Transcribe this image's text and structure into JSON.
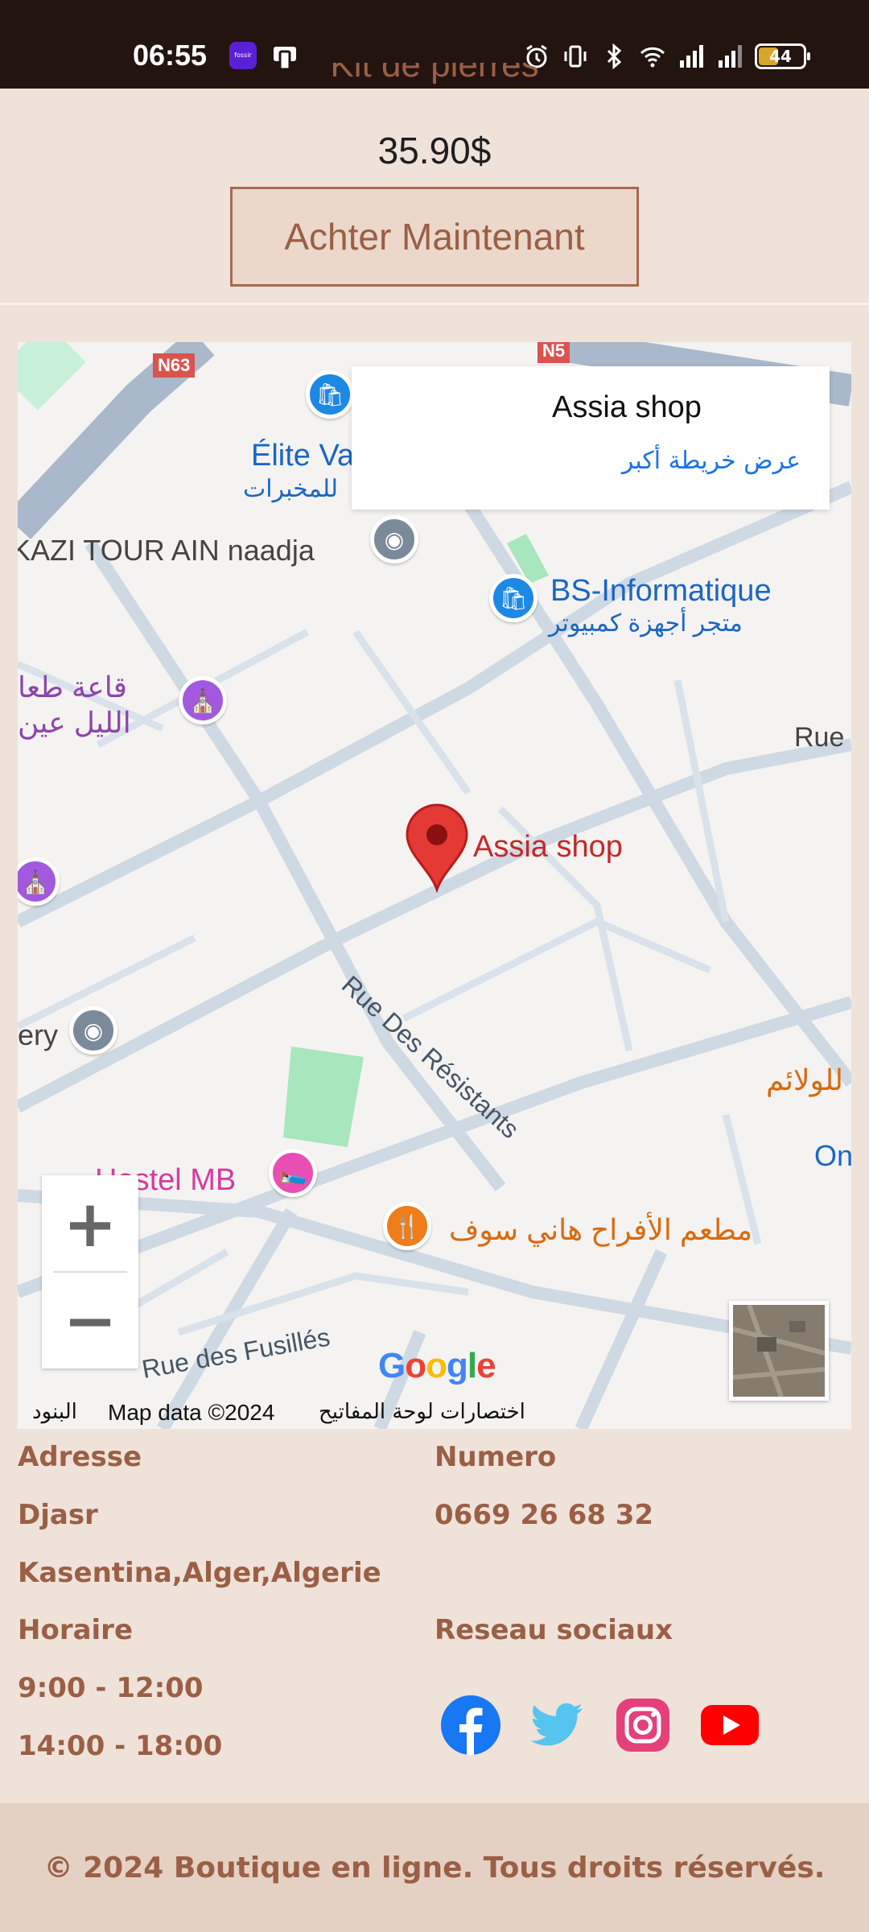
{
  "status_bar": {
    "time": "06:55",
    "app_icon_label": "fossir",
    "battery": "44",
    "icons": [
      "alarm-icon",
      "vibrate-icon",
      "bluetooth-icon",
      "wifi-icon",
      "signal-icon",
      "signal-icon",
      "battery-icon"
    ]
  },
  "product": {
    "name": "Kit de pierres",
    "price": "35.90$",
    "buy_label": "Achter Maintenant"
  },
  "map": {
    "info_card": {
      "title": "Assia shop",
      "larger_map_link": "عرض خريطة أكبر"
    },
    "marker_label": "Assia shop",
    "labels": {
      "road_n63": "N63",
      "road_n5": "N5",
      "elite": "Élite Va",
      "elite_ar": "للمخبرات",
      "kazi": "KAZI TOUR AIN naadja",
      "bs_info": "BS-Informatique",
      "bs_info_ar": "متجر أجهزة كمبيوتر",
      "hall_ar_1": "قاعة طعا",
      "hall_ar_2": "الليل عين",
      "rue_right": "Rue",
      "rue_resistants": "Rue Des Résistants",
      "ery": "ery",
      "hostel": "Hostel MB",
      "wedding": "مطعم الأفراح هاني سوف",
      "walaim": "للولائم",
      "on": "On",
      "rue_fusilles": "Rue des Fusillés"
    },
    "google": "Google",
    "attribution": {
      "terms": "البنود",
      "map_data": "Map data ©2024",
      "shortcuts": "اختصارات لوحة المفاتيح"
    },
    "zoom_in": "+",
    "zoom_out": "−"
  },
  "contact": {
    "address_heading": "Adresse",
    "address_line1": "Djasr",
    "address_line2": "Kasentina,Alger,Algerie",
    "hours_heading": "Horaire",
    "hours_1": "9:00 - 12:00",
    "hours_2": "14:00 - 18:00",
    "phone_heading": "Numero",
    "phone": "0669 26 68 32",
    "social_heading": "Reseau sociaux"
  },
  "social_icons": [
    "facebook-icon",
    "twitter-icon",
    "instagram-icon",
    "youtube-icon"
  ],
  "footer": {
    "copyright": "© 2024 Boutique en ligne. Tous droits réservés."
  },
  "colors": {
    "accent": "#9a5f45",
    "background": "#efe2d9",
    "footer_bg": "#e4d1c3",
    "status_bar": "#231410"
  }
}
